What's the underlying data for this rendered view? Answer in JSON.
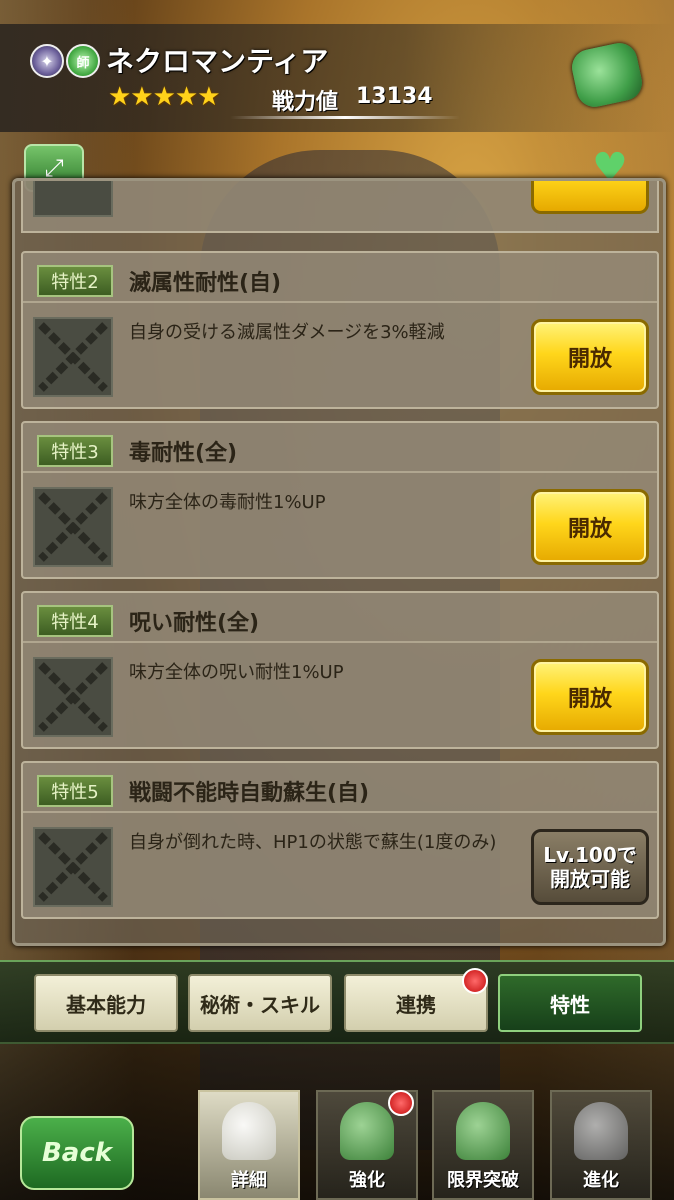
{
  "header": {
    "character_name": "ネクロマンティア",
    "stars": "★★★★★",
    "power_label": "戦力値",
    "power_value": "13134",
    "class_icon_text": "師"
  },
  "traits": [
    {
      "tag": "特性2",
      "name": "滅属性耐性(自)",
      "description": "自身の受ける滅属性ダメージを3%軽減",
      "button": "開放"
    },
    {
      "tag": "特性3",
      "name": "毒耐性(全)",
      "description": "味方全体の毒耐性1%UP",
      "button": "開放"
    },
    {
      "tag": "特性4",
      "name": "呪い耐性(全)",
      "description": "味方全体の呪い耐性1%UP",
      "button": "開放"
    },
    {
      "tag": "特性5",
      "name": "戦闘不能時自動蘇生(自)",
      "description": "自身が倒れた時、HP1の状態で蘇生(1度のみ)",
      "locked_line1": "Lv.100で",
      "locked_line2": "開放可能"
    }
  ],
  "tabs": [
    {
      "label": "基本能力"
    },
    {
      "label": "秘術・スキル"
    },
    {
      "label": "連携"
    },
    {
      "label": "特性"
    }
  ],
  "bottom_nav": {
    "back_label": "Back",
    "items": [
      {
        "label": "詳細"
      },
      {
        "label": "強化"
      },
      {
        "label": "限界突破"
      },
      {
        "label": "進化"
      }
    ]
  }
}
